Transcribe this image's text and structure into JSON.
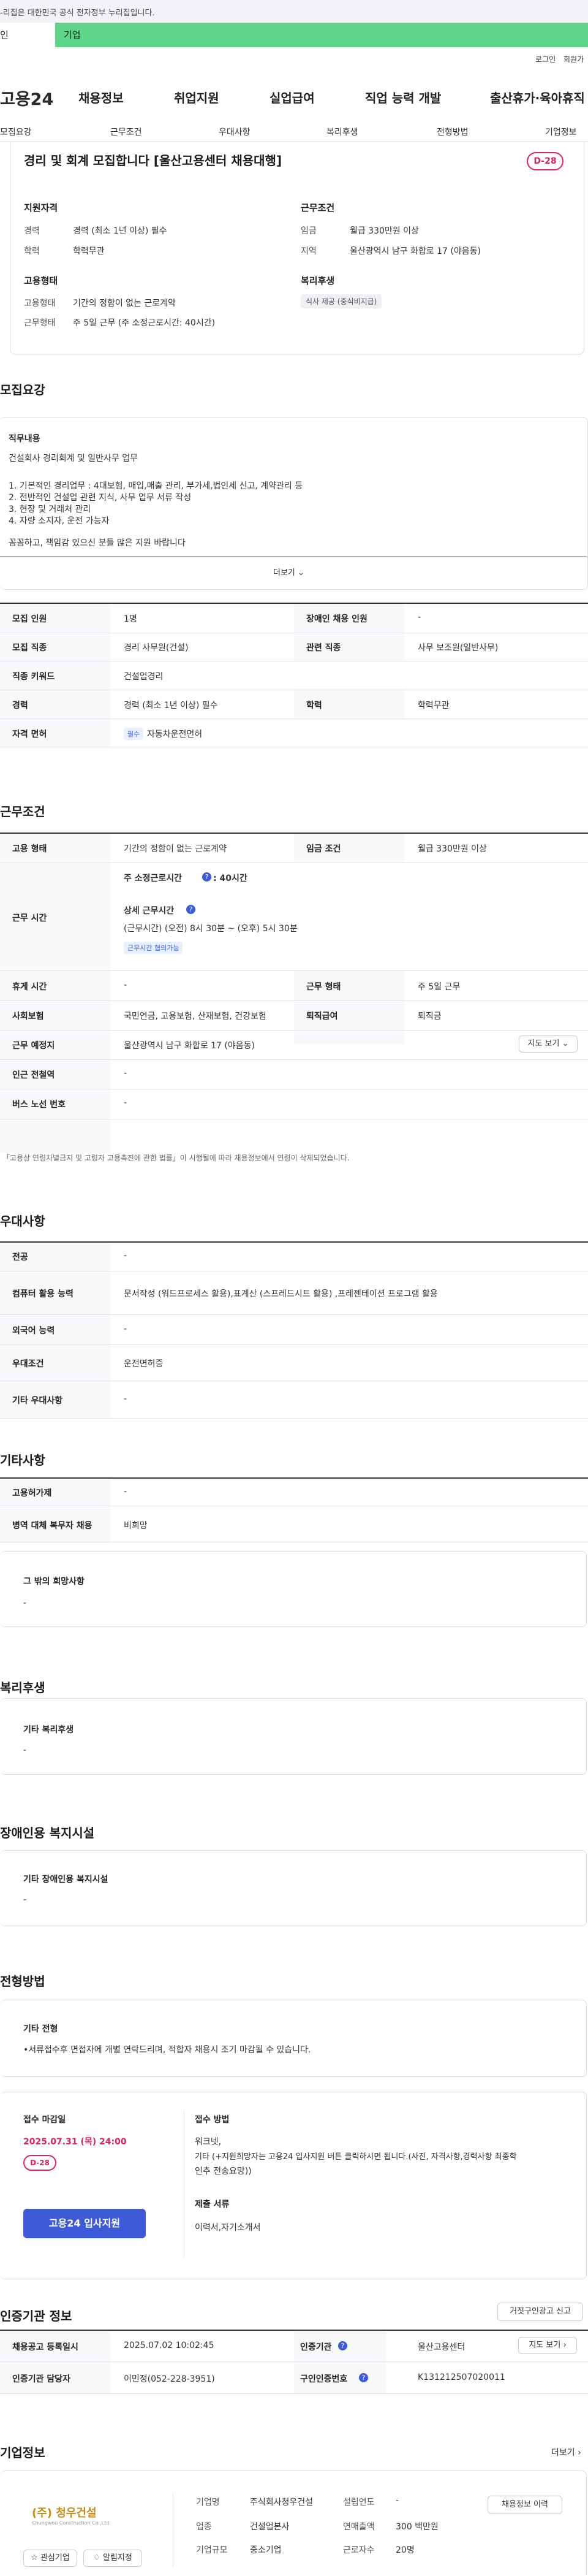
{
  "gov_banner": "-리집은 대한민국 공식 전자정부 누리집입니다.",
  "top_tabs": [
    "인",
    "기업"
  ],
  "util_links": [
    "로그인",
    "회원가"
  ],
  "site_logo": "고용24",
  "gnb": [
    "채용정보",
    "취업지원",
    "실업급여",
    "직업 능력 개발",
    "출산휴가·육아휴직"
  ],
  "sub_tabs": [
    "모집요강",
    "근무조건",
    "우대사항",
    "복리후생",
    "전형방법",
    "기업정보"
  ],
  "headline": "경리 및 회계 모집합니다 [울산고용센터 채용대행]",
  "dday": "D-28",
  "summary": {
    "qual_title": "지원자격",
    "qual": [
      [
        "경력",
        "경력 (최소 1년 이상) 필수"
      ],
      [
        "학력",
        "학력무관"
      ]
    ],
    "cond_title": "근무조건",
    "cond": [
      [
        "임금",
        "월급 330만원 이상"
      ],
      [
        "지역",
        "울산광역시 남구 화합로 17 (야음동)"
      ]
    ],
    "emp_title": "고용형태",
    "emp": [
      [
        "고용형태",
        "기간의 정함이 없는 근로계약"
      ],
      [
        "근무형태",
        "주 5일 근무 (주 소정근로시간: 40시간)"
      ]
    ],
    "welfare_title": "복리후생",
    "welfare_chip": "식사 제공 (중식비지급)"
  },
  "recruit": {
    "title": "모집요강",
    "job_title": "직무내용",
    "lines": [
      "건설회사 경리회계 및 일반사무 업무",
      "",
      "1. 기본적인 경리업무 : 4대보험, 매입,매출 관리, 부가세,법인세 신고, 계약관리 등",
      "2. 전반적인 건설업 관련 지식, 사무 업무 서류 작성",
      "3. 현장 및 거래처 관리",
      "4. 자량 소지자, 운전 가능자",
      "",
      "꼼꼼하고, 책임감 있으신 분들 많은 지원 바랍니다"
    ],
    "more": "더보기 ⌄",
    "rows": [
      [
        "모집 인원",
        "1명",
        "장애인 채용 인원",
        "-"
      ],
      [
        "모집 직종",
        "경리 사무원(건설)",
        "관련 직종",
        "사무 보조원(일반사무)"
      ],
      [
        "직종 키워드",
        "건설업경리",
        "",
        ""
      ],
      [
        "경력",
        "경력 (최소 1년 이상) 필수",
        "학력",
        "학력무관"
      ],
      [
        "자격 면허",
        "자동차운전면허",
        "",
        ""
      ]
    ],
    "license_tag": "필수"
  },
  "work": {
    "title": "근무조건",
    "employ": [
      "고용 형태",
      "기간의 정함이 없는 근로계약",
      "임금 조건",
      "월급 330만원 이상"
    ],
    "hours_label": "근무 시간",
    "hours_main": "주 소정근로시간 ",
    "hours_val": ": 40시간",
    "detail_title": "상세 근무시간",
    "detail": "(근무시간) (오전) 8시 30분 ~ (오후) 5시 30분",
    "flex_tag": "근무시간 협의가능",
    "rows": [
      [
        "휴게 시간",
        "-",
        "근무 형태",
        "주 5일 근무"
      ],
      [
        "사회보험",
        "국민연금, 고용보험, 산재보험, 건강보험",
        "퇴직급여",
        "퇴직금"
      ],
      [
        "근무 예정지",
        "울산광역시 남구 화합로 17 (야음동)",
        "",
        ""
      ],
      [
        "인근 전철역",
        "-",
        "",
        ""
      ],
      [
        "버스 노선 번호",
        "-",
        "",
        ""
      ]
    ],
    "map_btn": "지도 보기 ⌄",
    "note": "「고용상 연령차별금지 및 고령자 고용촉진에 관한 법률」이 시행될에 따라 채용정보에서 연령이 삭제되었습니다."
  },
  "pref": {
    "title": "우대사항",
    "rows": [
      [
        "전공",
        "-"
      ],
      [
        "컴퓨터 활용 능력",
        "문서작성 (워드프로세스 활용),표계산 (스프레드시트 활용) ,프레젠테이션 프로그램 활용"
      ],
      [
        "외국어 능력",
        "-"
      ],
      [
        "우대조건",
        "운전면허증"
      ],
      [
        "기타 우대사항",
        "-"
      ]
    ]
  },
  "etc": {
    "title": "기타사항",
    "rows": [
      [
        "고용허가제",
        "-"
      ],
      [
        "병역 대체 복무자 채용",
        "비희망"
      ]
    ],
    "box_title": "그 밖의 희망사항",
    "box_val": "-"
  },
  "benefit": {
    "title": "복리후생",
    "box_title": "기타 복리후생",
    "box_val": "-"
  },
  "disabled": {
    "title": "장애인용 복지시설",
    "box_title": "기타 장애인용 복지시설",
    "box_val": "-"
  },
  "select": {
    "title": "전형방법",
    "box_title": "기타 전형",
    "box_val": "•서류접수후 면접자에 개별 연락드리며, 적합자 채용시 조기 마감될 수 있습니다.",
    "deadline_title": "접수 마감일",
    "deadline": "2025.07.31 (목) 24:00",
    "dday": "D-28",
    "method_title": "접수 방법",
    "method": [
      "워크넷,",
      "기타 (+지원희망자는 고용24 입사지원 버튼 클릭하시면 됩니다.(사진, 자격사항,경력사항 최종학",
      "인추 전송요망))"
    ],
    "docs_title": "제출 서류",
    "docs": "이력서,자기소개서",
    "apply_btn": "고용24 입사지원"
  },
  "auth": {
    "title": "인증기관 정보",
    "report_btn": "거짓구인광고 신고",
    "rows": [
      [
        "채용공고 등록일시",
        "2025.07.02 10:02:45",
        "인증기관",
        "울산고용센터"
      ],
      [
        "인증기관 담당자",
        "이민정(052-228-3951)",
        "구인인증번호",
        "K131212507020011"
      ]
    ],
    "map_btn": "지도 보기 ›"
  },
  "company": {
    "title": "기업정보",
    "more": "더보기 ›",
    "logo_text": "(주) 청우건설",
    "logo_sub": "Chungwoo Construction Co.,Ltd",
    "info": [
      [
        "기업명",
        "주식회사청우건설"
      ],
      [
        "업종",
        "건설업본사"
      ],
      [
        "기업규모",
        "중소기업"
      ]
    ],
    "info2": [
      [
        "설립연도",
        "-"
      ],
      [
        "연매출액",
        "300 백만원"
      ],
      [
        "근로자수",
        "20명"
      ]
    ],
    "history_btn": "채용정보 이력",
    "fav_btn": "관심기업",
    "alarm_btn": "알림지정"
  }
}
